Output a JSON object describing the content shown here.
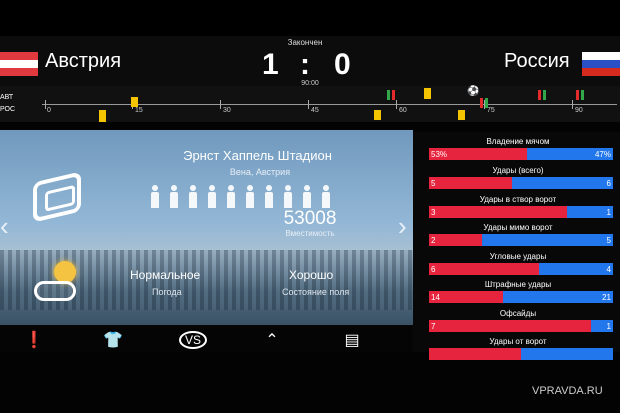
{
  "header": {
    "status": "Закончен",
    "home_team": "Австрия",
    "away_team": "Россия",
    "home_score": "1",
    "separator": ":",
    "away_score": "0",
    "minute": "90:00"
  },
  "timeline": {
    "home_abbr": "АВТ",
    "away_abbr": "РОС",
    "ticks": [
      "0",
      "15",
      "30",
      "45",
      "60",
      "75",
      "90"
    ],
    "icons": [
      "yellow-card-icon",
      "red-card-icon",
      "green-substitution-icon",
      "ball-icon"
    ]
  },
  "stadium": {
    "name": "Эрнст Хаппель Штадион",
    "city": "Вена, Австрия",
    "capacity": "53008",
    "capacity_label": "Вместимость",
    "weather": "Нормальное",
    "weather_label": "Погода",
    "field": "Хорошо",
    "field_label": "Состояние поля",
    "people_count": 10
  },
  "stats": [
    {
      "label": "Владение мячом",
      "home": "53%",
      "away": "47%",
      "home_fraction": 0.53
    },
    {
      "label": "Удары (всего)",
      "home": "5",
      "away": "6",
      "home_fraction": 0.45
    },
    {
      "label": "Удары в створ ворот",
      "home": "3",
      "away": "1",
      "home_fraction": 0.75
    },
    {
      "label": "Удары мимо ворот",
      "home": "2",
      "away": "5",
      "home_fraction": 0.29
    },
    {
      "label": "Угловые удары",
      "home": "6",
      "away": "4",
      "home_fraction": 0.6
    },
    {
      "label": "Штрафные удары",
      "home": "14",
      "away": "21",
      "home_fraction": 0.4
    },
    {
      "label": "Офсайды",
      "home": "7",
      "away": "1",
      "home_fraction": 0.88
    },
    {
      "label": "Удары от ворот",
      "home": "",
      "away": "",
      "home_fraction": 0.5
    }
  ],
  "bottom_nav": {
    "items": [
      "alert-icon",
      "shirt-icon",
      "vs-icon",
      "lineup-icon",
      "stats-icon"
    ]
  },
  "watermark": "VPRAVDA.RU",
  "colors": {
    "home": "#e7243d",
    "away": "#2277ed",
    "yellow": "#f5c400",
    "green": "#33a84a"
  }
}
